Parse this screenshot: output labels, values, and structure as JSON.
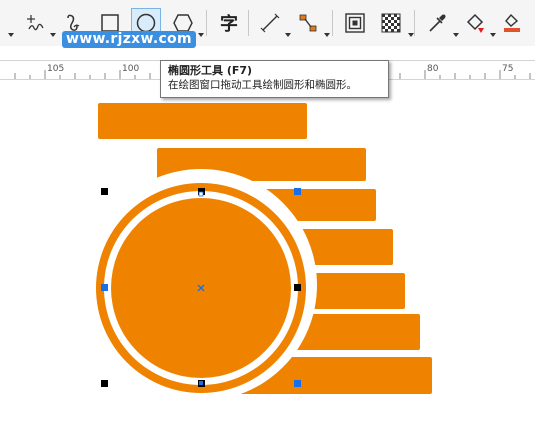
{
  "toolbar": {
    "tools": [
      {
        "name": "freehand-tool",
        "icon": "freehand-icon"
      },
      {
        "name": "smart-drawing-tool",
        "icon": "smart-drawing-icon"
      },
      {
        "name": "rectangle-tool",
        "icon": "rectangle-icon"
      },
      {
        "name": "ellipse-tool",
        "icon": "ellipse-icon",
        "active": true
      },
      {
        "name": "polygon-tool",
        "icon": "polygon-icon"
      },
      {
        "name": "text-tool",
        "icon": "text-icon",
        "glyph": "字"
      },
      {
        "name": "parallel-dimension-tool",
        "icon": "dimension-icon"
      },
      {
        "name": "connector-tool",
        "icon": "connector-icon"
      },
      {
        "name": "contour-tool",
        "icon": "contour-icon"
      },
      {
        "name": "transparency-tool",
        "icon": "transparency-icon"
      },
      {
        "name": "eyedropper-tool",
        "icon": "eyedropper-icon"
      },
      {
        "name": "interactive-fill-tool",
        "icon": "fill-bucket-icon"
      },
      {
        "name": "smart-fill-tool",
        "icon": "smart-fill-icon"
      }
    ]
  },
  "watermark": "www.rjzxw.com",
  "ruler": {
    "labels": [
      "105",
      "100",
      "80",
      "75"
    ]
  },
  "tooltip": {
    "title": "椭圆形工具 (F7)",
    "description": "在绘图窗口拖动工具绘制圆形和椭圆形。"
  },
  "colors": {
    "shape_fill": "#ef8300",
    "selection_handle": "#000000",
    "selected_node": "#1a6fe8",
    "toolbar_bg": "#f5f5f5",
    "accent": "#d9ecfb"
  }
}
